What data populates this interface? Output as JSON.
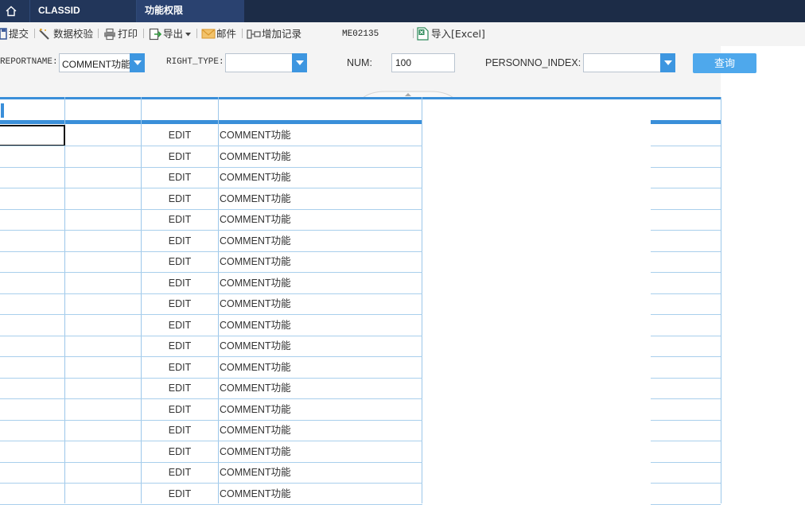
{
  "tabs": {
    "home_icon": "home-icon",
    "items": [
      {
        "label": "CLASSID"
      },
      {
        "label": "功能权限"
      }
    ]
  },
  "toolbar": {
    "submit": "提交",
    "validate": "数据校验",
    "print": "打印",
    "export": "导出",
    "mail": "邮件",
    "add_record": "增加记录",
    "code": "ME02135",
    "import_excel": "导入[Excel]"
  },
  "filter": {
    "reportname_label": "REPORTNAME:",
    "reportname_value": "COMMENT功能",
    "right_type_label": "RIGHT_TYPE:",
    "right_type_value": "",
    "num_label": "NUM:",
    "num_value": "100",
    "personno_label": "PERSONNO_INDEX:",
    "personno_value": "",
    "query_button": "查询"
  },
  "grid": {
    "rows": [
      {
        "right_type": "EDIT",
        "reportname": "COMMENT功能"
      },
      {
        "right_type": "EDIT",
        "reportname": "COMMENT功能"
      },
      {
        "right_type": "EDIT",
        "reportname": "COMMENT功能"
      },
      {
        "right_type": "EDIT",
        "reportname": "COMMENT功能"
      },
      {
        "right_type": "EDIT",
        "reportname": "COMMENT功能"
      },
      {
        "right_type": "EDIT",
        "reportname": "COMMENT功能"
      },
      {
        "right_type": "EDIT",
        "reportname": "COMMENT功能"
      },
      {
        "right_type": "EDIT",
        "reportname": "COMMENT功能"
      },
      {
        "right_type": "EDIT",
        "reportname": "COMMENT功能"
      },
      {
        "right_type": "EDIT",
        "reportname": "COMMENT功能"
      },
      {
        "right_type": "EDIT",
        "reportname": "COMMENT功能"
      },
      {
        "right_type": "EDIT",
        "reportname": "COMMENT功能"
      },
      {
        "right_type": "EDIT",
        "reportname": "COMMENT功能"
      },
      {
        "right_type": "EDIT",
        "reportname": "COMMENT功能"
      },
      {
        "right_type": "EDIT",
        "reportname": "COMMENT功能"
      },
      {
        "right_type": "EDIT",
        "reportname": "COMMENT功能"
      },
      {
        "right_type": "EDIT",
        "reportname": "COMMENT功能"
      },
      {
        "right_type": "EDIT",
        "reportname": "COMMENT功能"
      }
    ]
  },
  "colors": {
    "tabbar": "#1c2c47",
    "accent": "#3d96e0",
    "grid_line": "#a9cfec",
    "header_bar": "#3a8fd9"
  }
}
